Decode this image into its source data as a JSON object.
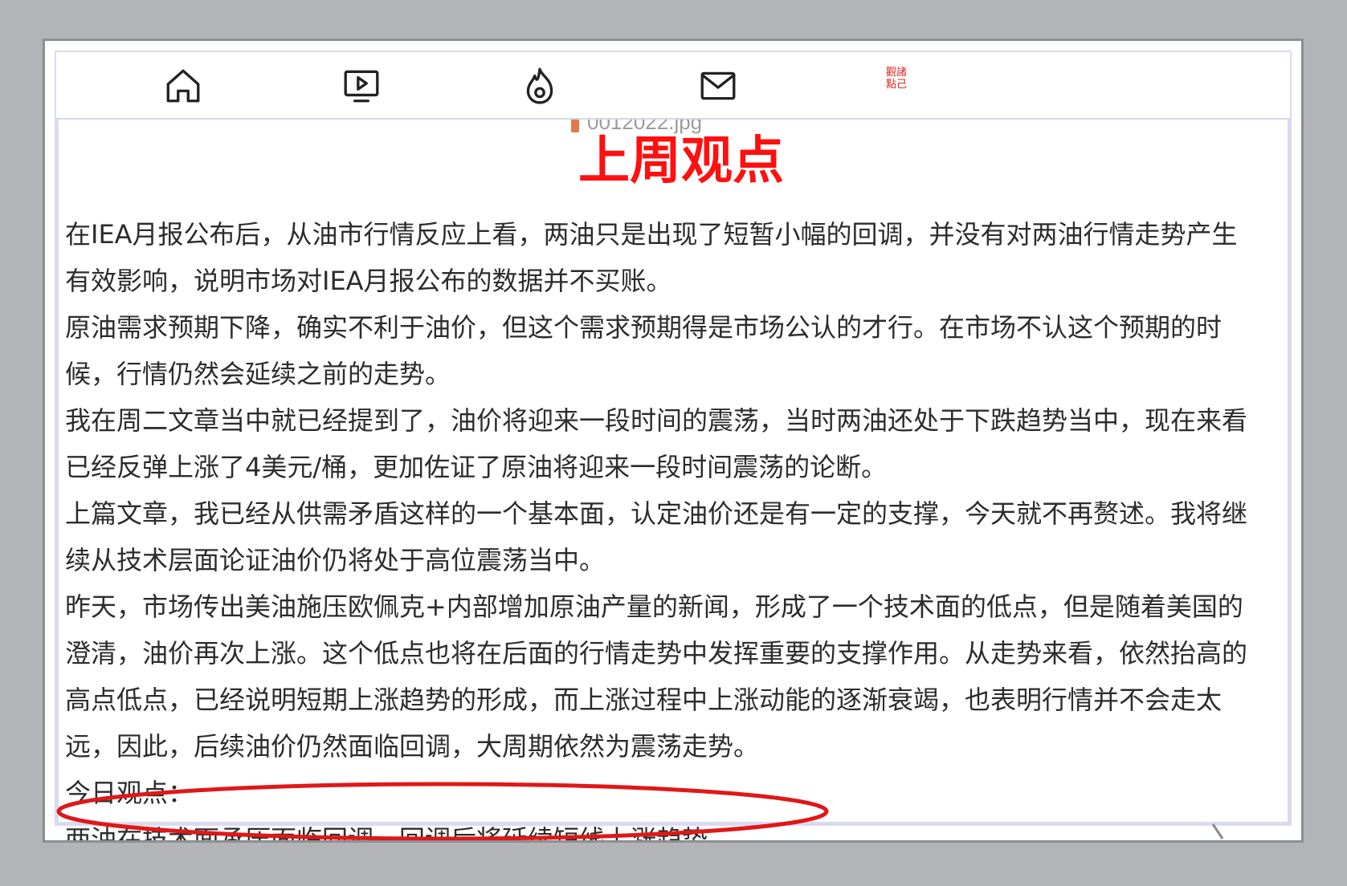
{
  "navbar": {
    "items": [
      {
        "icon": "home-icon"
      },
      {
        "icon": "video-icon"
      },
      {
        "icon": "fire-icon"
      },
      {
        "icon": "mail-icon"
      },
      {
        "icon": "red-seal-icon",
        "label": "觀諸\n點己"
      }
    ]
  },
  "file": {
    "name": "0012022.jpg"
  },
  "article": {
    "title": "上周观点",
    "paragraphs": [
      "在IEA月报公布后，从油市行情反应上看，两油只是出现了短暂小幅的回调，并没有对两油行情走势产生有效影响，说明市场对IEA月报公布的数据并不买账。",
      "原油需求预期下降，确实不利于油价，但这个需求预期得是市场公认的才行。在市场不认这个预期的时候，行情仍然会延续之前的走势。",
      "我在周二文章当中就已经提到了，油价将迎来一段时间的震荡，当时两油还处于下跌趋势当中，现在来看已经反弹上涨了4美元/桶，更加佐证了原油将迎来一段时间震荡的论断。",
      "上篇文章，我已经从供需矛盾这样的一个基本面，认定油价还是有一定的支撑，今天就不再赘述。我将继续从技术层面论证油价仍将处于高位震荡当中。",
      "昨天，市场传出美油施压欧佩克+内部增加原油产量的新闻，形成了一个技术面的低点，但是随着美国的澄清，油价再次上涨。这个低点也将在后面的行情走势中发挥重要的支撑作用。从走势来看，依然抬高的高点低点，已经说明短期上涨趋势的形成，而上涨过程中上涨动能的逐渐衰竭，也表明行情并不会走太远，因此，后续油价仍然面临回调，大周期依然为震荡走势。",
      "今日观点：",
      "两油在技术面承压面临回调，回调后将延续短线上涨趋势。"
    ]
  },
  "colors": {
    "title": "#ff1010",
    "ellipse": "#e01818",
    "text": "#2c2c2c"
  }
}
